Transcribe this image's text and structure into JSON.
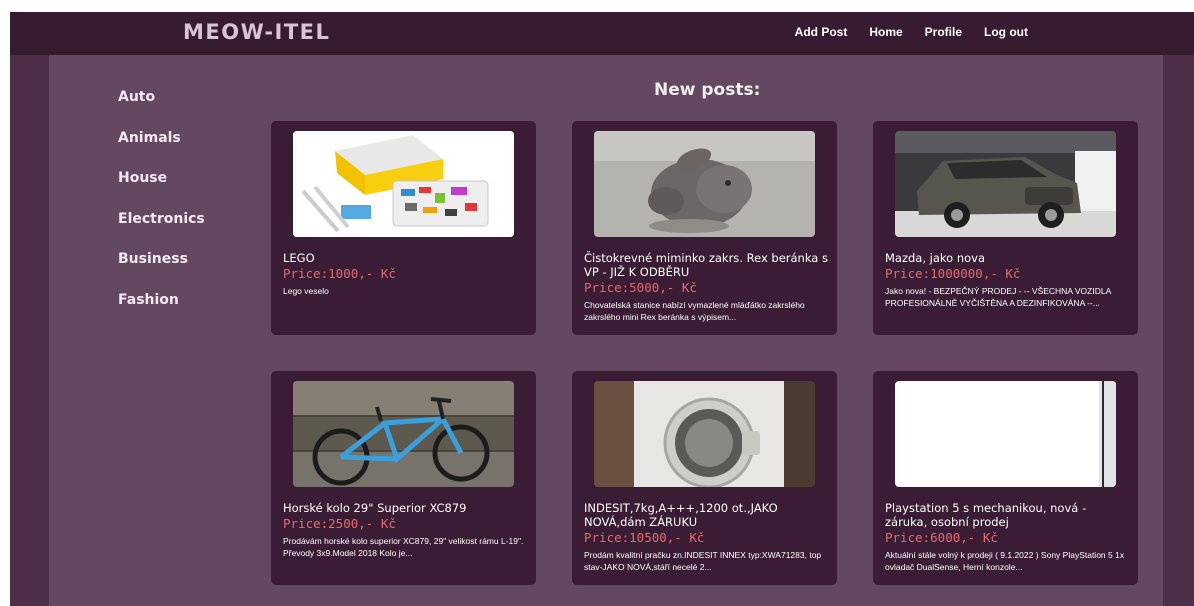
{
  "app": {
    "logo": "MEOW-ITEL"
  },
  "nav": {
    "links": [
      "Add Post",
      "Home",
      "Profile",
      "Log out"
    ]
  },
  "sidebar": {
    "categories": [
      "Auto",
      "Animals",
      "House",
      "Electronics",
      "Business",
      "Fashion"
    ]
  },
  "main": {
    "heading": "New posts:",
    "posts": [
      {
        "title": "LEGO",
        "price": "Price:1000,- Kč",
        "desc": "Lego veselo",
        "image": "lego-set-photo"
      },
      {
        "title": "Čistokrevné miminko zakrs. Rex beránka s VP - JIŽ K ODBĚRU",
        "price": "Price:5000,- Kč",
        "desc": "Chovatelská stanice nabízí vymazlené mláďátko zakrslého zakrslého mini Rex beránka s výpisem...",
        "image": "rabbit-photo"
      },
      {
        "title": "Mazda, jako nova",
        "price": "Price:1000000,- Kč",
        "desc": "Jako nova! - BEZPEČNÝ PRODEJ - -- VŠECHNA VOZIDLA PROFESIONÁLNĚ VYČIŠTĚNA A DEZINFIKOVÁNA --...",
        "image": "mazda-car-photo"
      },
      {
        "title": "Horské kolo 29\" Superior XC879",
        "price": "Price:2500,- Kč",
        "desc": "Prodávám horské kolo superior XC879, 29\" velikost rámu L-19\". Převody 3x9.Model 2018 Kolo je...",
        "image": "bicycle-photo"
      },
      {
        "title": "INDESIT,7kg,A+++,1200 ot.,JAKO NOVÁ,dám ZÁRUKU",
        "price": "Price:10500,- Kč",
        "desc": "Prodám kvalitní pračku zn.INDESIT INNEX typ:XWA71283, top stav-JAKO NOVÁ,stáří necelé 2...",
        "image": "washing-machine-photo"
      },
      {
        "title": "Playstation 5 s mechanikou, nová - záruka, osobní prodej",
        "price": "Price:6000,- Kč",
        "desc": "Aktuální stále volný k prodeji ( 9.1.2022 ) Sony PlayStation 5 1x ovladač DualSense, Herní konzole...",
        "image": "playstation-photo"
      }
    ]
  }
}
